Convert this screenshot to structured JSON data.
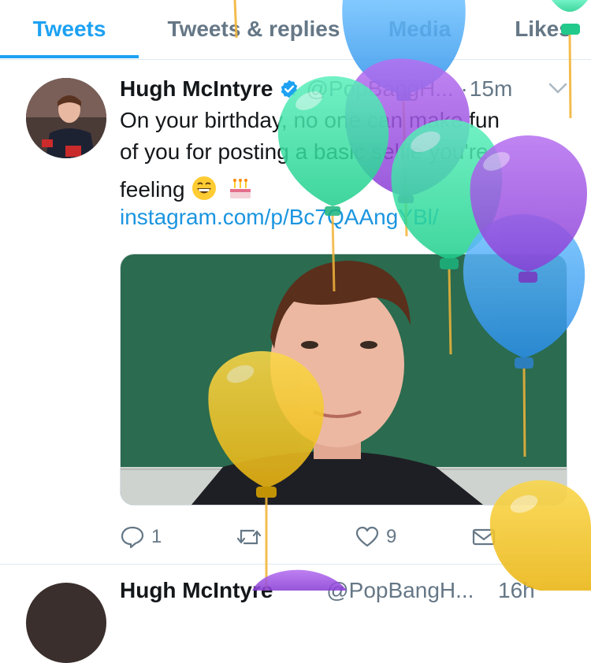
{
  "tabs": [
    {
      "label": "Tweets",
      "active": true
    },
    {
      "label": "Tweets & replies",
      "active": false
    },
    {
      "label": "Media",
      "active": false
    },
    {
      "label": "Likes",
      "active": false
    }
  ],
  "tweet": {
    "author_name": "Hugh McIntyre",
    "handle": "@PopBangH...",
    "separator": "·",
    "time": "15m",
    "text_line1": "On your birthday, no one can make fun",
    "text_line2": "of you for posting a basic selfie you're",
    "text_line3": "feeling",
    "link": "instagram.com/p/Bc7QAAngYBl/",
    "reply_count": "1",
    "retweet_count": "",
    "like_count": "9"
  },
  "next_tweet": {
    "author_name": "Hugh McIntyre",
    "handle": "@PopBangH...",
    "time": "16h"
  },
  "colors": {
    "accent": "#1da1f2",
    "link": "#1b95e0",
    "muted": "#657786",
    "balloon_blue": "#4aa8f0",
    "balloon_green": "#3ee0a8",
    "balloon_purple": "#a653e6",
    "balloon_yellow": "#f5c623"
  },
  "icons": {
    "verified": "verified-badge-icon",
    "caret": "chevron-down-icon",
    "reply": "reply-icon",
    "retweet": "retweet-icon",
    "like": "heart-icon",
    "dm": "envelope-icon",
    "emoji1": "grinning-face-emoji",
    "emoji2": "birthday-cake-emoji"
  }
}
